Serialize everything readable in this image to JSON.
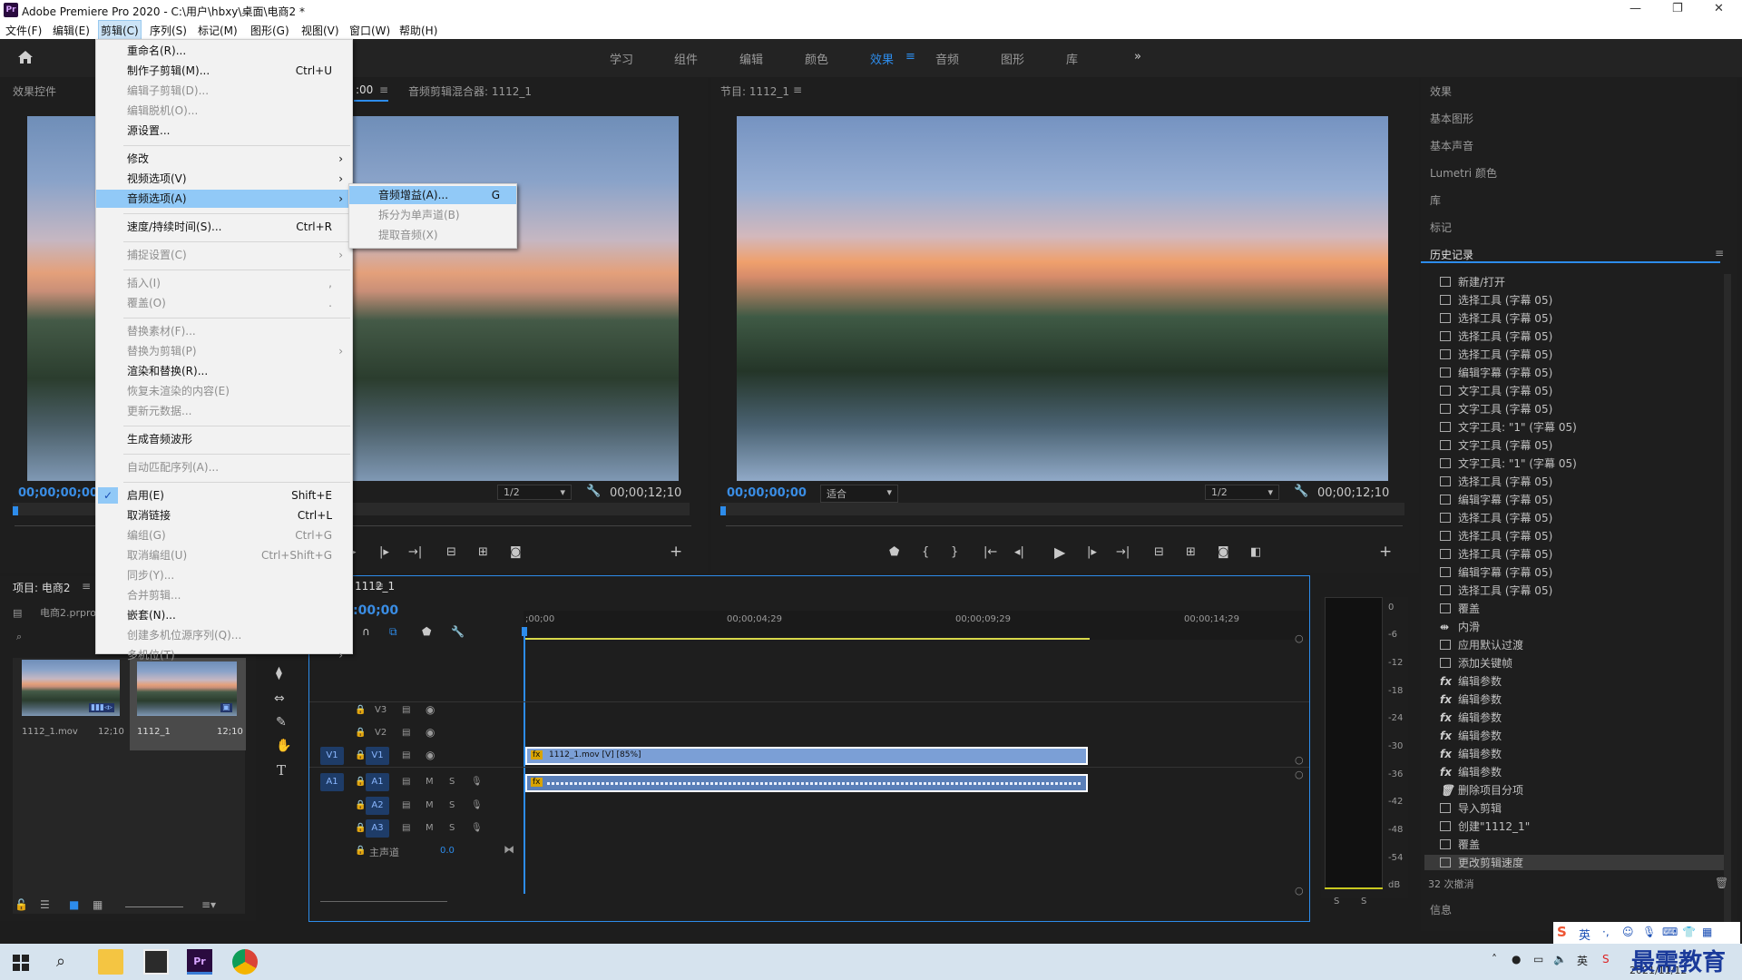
{
  "window": {
    "title": "Adobe Premiere Pro 2020 - C:\\用户\\hbxy\\桌面\\电商2 *",
    "logo": "Pr"
  },
  "menubar": [
    {
      "label": "文件(F)"
    },
    {
      "label": "编辑(E)"
    },
    {
      "label": "剪辑(C)"
    },
    {
      "label": "序列(S)"
    },
    {
      "label": "标记(M)"
    },
    {
      "label": "图形(G)"
    },
    {
      "label": "视图(V)"
    },
    {
      "label": "窗口(W)"
    },
    {
      "label": "帮助(H)"
    }
  ],
  "workspaces": {
    "items": [
      "学习",
      "组件",
      "编辑",
      "颜色",
      "效果",
      "音频",
      "图形",
      "库"
    ],
    "active": "效果",
    "more": "»"
  },
  "source_panel": {
    "tab_effect_controls": "效果控件",
    "tab_audio_mixer": "音频剪辑混合器: 1112_1",
    "partial_tc": ":00",
    "timecode_left": "00;00;00;00",
    "resolution": "1/2",
    "duration": "00;00;12;10"
  },
  "program_panel": {
    "title": "节目: 1112_1",
    "timecode": "00;00;00;00",
    "fit": "适合",
    "resolution": "1/2",
    "duration": "00;00;12;10"
  },
  "project_panel": {
    "title": "项目: 电商2",
    "file": "电商2.prproj",
    "clips": [
      {
        "name": "1112_1.mov",
        "duration": "12;10"
      },
      {
        "name": "1112_1",
        "duration": "12;10"
      }
    ]
  },
  "timeline": {
    "tab": "1112_1",
    "timecode": ":00;00",
    "ruler": [
      ";00;00",
      "00;00;04;29",
      "00;00;09;29",
      "00;00;14;29"
    ],
    "video_tracks": [
      "V3",
      "V2",
      "V1"
    ],
    "audio_tracks": [
      "A1",
      "A2",
      "A3"
    ],
    "src_v": "V1",
    "src_a": "A1",
    "master_label": "主声道",
    "master_value": "0.0",
    "mute_label": "M",
    "solo_label": "S",
    "video_clip": "1112_1.mov [V] [85%]"
  },
  "audio_meter": {
    "scale": [
      "0",
      "-6",
      "-12",
      "-18",
      "-24",
      "-30",
      "-36",
      "-42",
      "-48",
      "-54",
      "dB"
    ],
    "solo": [
      "S",
      "S"
    ]
  },
  "right_panels": {
    "items": [
      "效果",
      "基本图形",
      "基本声音",
      "Lumetri 颜色",
      "库",
      "标记"
    ],
    "history_title": "历史记录",
    "history": [
      {
        "label": "新建/打开",
        "icon": "doc"
      },
      {
        "label": "选择工具 (字幕 05)",
        "icon": "doc"
      },
      {
        "label": "选择工具 (字幕 05)",
        "icon": "doc"
      },
      {
        "label": "选择工具 (字幕 05)",
        "icon": "doc"
      },
      {
        "label": "选择工具 (字幕 05)",
        "icon": "doc"
      },
      {
        "label": "编辑字幕 (字幕 05)",
        "icon": "doc"
      },
      {
        "label": "文字工具 (字幕 05)",
        "icon": "doc"
      },
      {
        "label": "文字工具 (字幕 05)",
        "icon": "doc"
      },
      {
        "label": "文字工具: \"1\" (字幕 05)",
        "icon": "doc"
      },
      {
        "label": "文字工具 (字幕 05)",
        "icon": "doc"
      },
      {
        "label": "文字工具: \"1\" (字幕 05)",
        "icon": "doc"
      },
      {
        "label": "选择工具 (字幕 05)",
        "icon": "doc"
      },
      {
        "label": "编辑字幕 (字幕 05)",
        "icon": "doc"
      },
      {
        "label": "选择工具 (字幕 05)",
        "icon": "doc"
      },
      {
        "label": "选择工具 (字幕 05)",
        "icon": "doc"
      },
      {
        "label": "选择工具 (字幕 05)",
        "icon": "doc"
      },
      {
        "label": "编辑字幕 (字幕 05)",
        "icon": "doc"
      },
      {
        "label": "选择工具 (字幕 05)",
        "icon": "doc"
      },
      {
        "label": "覆盖",
        "icon": "doc"
      },
      {
        "label": "内滑",
        "icon": "slide"
      },
      {
        "label": "应用默认过渡",
        "icon": "doc"
      },
      {
        "label": "添加关键帧",
        "icon": "doc"
      },
      {
        "label": "编辑参数",
        "icon": "fx"
      },
      {
        "label": "编辑参数",
        "icon": "fx"
      },
      {
        "label": "编辑参数",
        "icon": "fx"
      },
      {
        "label": "编辑参数",
        "icon": "fx"
      },
      {
        "label": "编辑参数",
        "icon": "fx"
      },
      {
        "label": "编辑参数",
        "icon": "fx"
      },
      {
        "label": "删除项目分项",
        "icon": "trash"
      },
      {
        "label": "导入剪辑",
        "icon": "doc"
      },
      {
        "label": "创建\"1112_1\"",
        "icon": "doc"
      },
      {
        "label": "覆盖",
        "icon": "doc"
      },
      {
        "label": "更改剪辑速度",
        "icon": "doc"
      }
    ],
    "undo_count": "32 次撤消",
    "info": "信息"
  },
  "clip_menu": [
    {
      "label": "重命名(R)...",
      "dis": false
    },
    {
      "label": "制作子剪辑(M)...",
      "sc": "Ctrl+U",
      "dis": false
    },
    {
      "label": "编辑子剪辑(D)...",
      "dis": true
    },
    {
      "label": "编辑脱机(O)...",
      "dis": true
    },
    {
      "label": "源设置...",
      "dis": false
    },
    {
      "sep": true
    },
    {
      "label": "修改",
      "arrow": true,
      "dis": false
    },
    {
      "label": "视频选项(V)",
      "arrow": true,
      "dis": false
    },
    {
      "label": "音频选项(A)",
      "arrow": true,
      "dis": false,
      "hl": true
    },
    {
      "sep": true
    },
    {
      "label": "速度/持续时间(S)...",
      "sc": "Ctrl+R",
      "dis": false
    },
    {
      "sep": true
    },
    {
      "label": "捕捉设置(C)",
      "arrow": true,
      "dis": true
    },
    {
      "sep": true
    },
    {
      "label": "插入(I)",
      "sc": ",",
      "dis": true
    },
    {
      "label": "覆盖(O)",
      "sc": ".",
      "dis": true
    },
    {
      "sep": true
    },
    {
      "label": "替换素材(F)...",
      "dis": true
    },
    {
      "label": "替换为剪辑(P)",
      "arrow": true,
      "dis": true
    },
    {
      "label": "渲染和替换(R)...",
      "dis": false
    },
    {
      "label": "恢复未渲染的内容(E)",
      "dis": true
    },
    {
      "label": "更新元数据...",
      "dis": true
    },
    {
      "sep": true
    },
    {
      "label": "生成音频波形",
      "dis": false
    },
    {
      "sep": true
    },
    {
      "label": "自动匹配序列(A)...",
      "dis": true
    },
    {
      "sep": true
    },
    {
      "label": "启用(E)",
      "sc": "Shift+E",
      "dis": false,
      "check": true
    },
    {
      "label": "取消链接",
      "sc": "Ctrl+L",
      "dis": false
    },
    {
      "label": "编组(G)",
      "sc": "Ctrl+G",
      "dis": true
    },
    {
      "label": "取消编组(U)",
      "sc": "Ctrl+Shift+G",
      "dis": true
    },
    {
      "label": "同步(Y)...",
      "dis": true
    },
    {
      "label": "合并剪辑...",
      "dis": true
    },
    {
      "label": "嵌套(N)...",
      "dis": false
    },
    {
      "label": "创建多机位源序列(Q)...",
      "dis": true
    },
    {
      "label": "多机位(T)",
      "arrow": true,
      "dis": true
    }
  ],
  "audio_submenu": [
    {
      "label": "音频增益(A)...",
      "sc": "G",
      "dis": false,
      "hl": true
    },
    {
      "label": "拆分为单声道(B)",
      "dis": true
    },
    {
      "label": "提取音频(X)",
      "dis": true
    }
  ],
  "taskbar": {
    "ime": "英",
    "date": "2021/11/12",
    "watermark": "最需教育"
  },
  "colors": {
    "accent": "#2d8ceb",
    "timecode": "#3a8de4",
    "menu_highlight": "#91c9f7",
    "clip_video": "#7b9fd6"
  }
}
